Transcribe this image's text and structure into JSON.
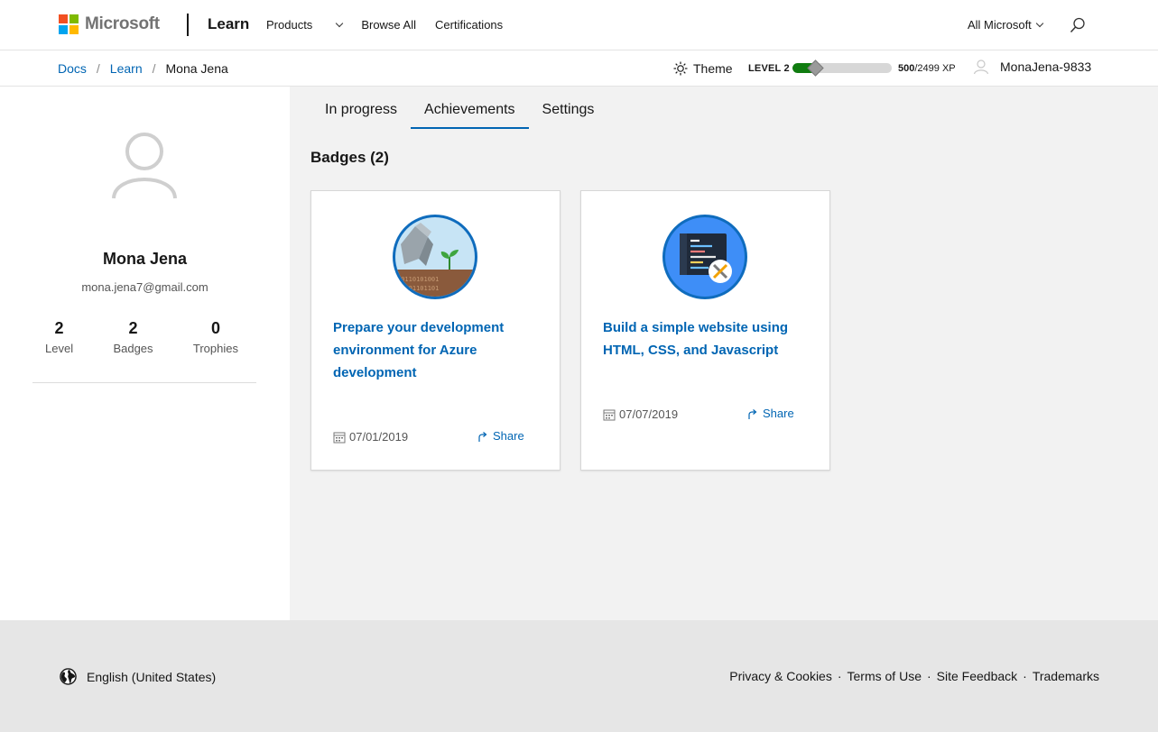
{
  "header": {
    "brand": "Microsoft",
    "product": "Learn",
    "nav": [
      {
        "label": "Products",
        "has_dropdown": true
      },
      {
        "label": "Browse All",
        "has_dropdown": false
      },
      {
        "label": "Certifications",
        "has_dropdown": false
      }
    ],
    "all_microsoft": "All Microsoft",
    "search_icon": "search-icon",
    "logo_colors": [
      "#f25022",
      "#7fba00",
      "#00a4ef",
      "#ffb900"
    ]
  },
  "subbar": {
    "breadcrumbs": [
      {
        "label": "Docs",
        "link": true
      },
      {
        "label": "Learn",
        "link": true
      },
      {
        "label": "Mona Jena",
        "link": false
      }
    ],
    "theme_label": "Theme",
    "level_label": "LEVEL 2",
    "xp_current": "500",
    "xp_total_text": "/2499 XP",
    "xp_progress": 0.2,
    "username": "MonaJena-9833"
  },
  "profile": {
    "name": "Mona Jena",
    "email": "mona.jena7@gmail.com",
    "stats": [
      {
        "value": "2",
        "label": "Level"
      },
      {
        "value": "2",
        "label": "Badges"
      },
      {
        "value": "0",
        "label": "Trophies"
      }
    ]
  },
  "main": {
    "tabs": [
      {
        "label": "In progress",
        "active": false
      },
      {
        "label": "Achievements",
        "active": true
      },
      {
        "label": "Settings",
        "active": false
      }
    ],
    "badges_heading": "Badges (2)",
    "badges": [
      {
        "title": "Prepare your development environment for Azure development",
        "date": "07/01/2019",
        "share": "Share",
        "icon": "plant-badge-icon"
      },
      {
        "title": "Build a simple website using HTML, CSS, and Javascript",
        "date": "07/07/2019",
        "share": "Share",
        "icon": "code-editor-badge-icon"
      }
    ]
  },
  "footer": {
    "language": "English (United States)",
    "links": [
      "Privacy & Cookies",
      "Terms of Use",
      "Site Feedback",
      "Trademarks"
    ]
  },
  "colors": {
    "link": "#0065b3",
    "xp_fill": "#107c10",
    "page_bg": "#f2f2f2",
    "footer_bg": "#e6e6e6"
  }
}
